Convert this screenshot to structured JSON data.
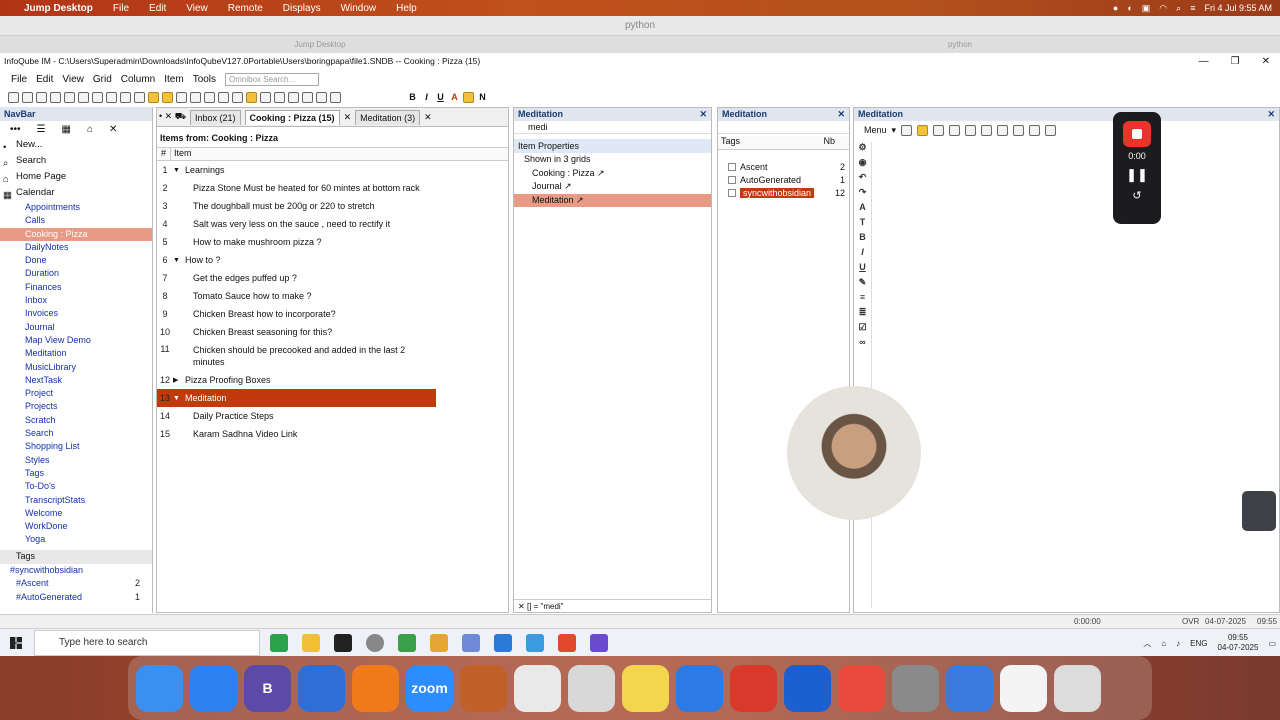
{
  "mac_menubar": {
    "app": "Jump Desktop",
    "items": [
      "File",
      "Edit",
      "View",
      "Remote",
      "Displays",
      "Window",
      "Help"
    ],
    "clock": "Fri 4 Jul  9:55 AM"
  },
  "remote_titlebar": "python",
  "remote_tabs": [
    "Jump Desktop",
    "python"
  ],
  "window": {
    "title": "InfoQube IM - C:\\Users\\Superadmin\\Downloads\\InfoQubeV127.0Portable\\Users\\boringpapa\\file1.SNDB -- Cooking : Pizza (15)"
  },
  "app_menu": [
    "File",
    "Edit",
    "View",
    "Grid",
    "Column",
    "Item",
    "Tools"
  ],
  "omnibox_placeholder": "Omnibox Search...",
  "navbar": {
    "title": "NavBar",
    "top": [
      "New...",
      "Search",
      "Home Page",
      "Calendar"
    ],
    "items": [
      "Appointments",
      "Calls",
      "Cooking : Pizza",
      "DailyNotes",
      "Done",
      "Duration",
      "Finances",
      "Inbox",
      "Invoices",
      "Journal",
      "Map View Demo",
      "Meditation",
      "MusicLibrary",
      "NextTask",
      "Project",
      "Projects",
      "Scratch",
      "Search",
      "Shopping List",
      "Styles",
      "Tags",
      "To-Do's",
      "TranscriptStats",
      "Welcome",
      "WorkDone",
      "Yoga"
    ],
    "selected": "Cooking : Pizza",
    "tags_label": "Tags",
    "tags": [
      {
        "name": "#syncwithobsidian",
        "count": ""
      },
      {
        "name": "#Ascent",
        "count": "2"
      },
      {
        "name": "#AutoGenerated",
        "count": "1"
      }
    ]
  },
  "grid_tabs": [
    "Inbox (21)",
    "Cooking : Pizza (15)",
    "Meditation (3)"
  ],
  "grid": {
    "header_prefix": "Items from:",
    "header_source": "Cooking : Pizza",
    "col_num": "#",
    "col_item": "Item",
    "rows": [
      {
        "n": "1",
        "text": "Learnings",
        "type": "parent"
      },
      {
        "n": "2",
        "text": "Pizza Stone Must be heated for 60 mintes at bottom rack",
        "type": "child"
      },
      {
        "n": "3",
        "text": "The doughball must be 200g or 220 to stretch",
        "type": "child"
      },
      {
        "n": "4",
        "text": "Salt was very less on the sauce , need to rectify it",
        "type": "child"
      },
      {
        "n": "5",
        "text": "How to make mushroom pizza ?",
        "type": "child"
      },
      {
        "n": "6",
        "text": "How to ?",
        "type": "parent"
      },
      {
        "n": "7",
        "text": "Get the edges puffed up ?",
        "type": "child"
      },
      {
        "n": "8",
        "text": "Tomato Sauce how to make ?",
        "type": "child"
      },
      {
        "n": "9",
        "text": "Chicken Breast how to incorporate?",
        "type": "child"
      },
      {
        "n": "10",
        "text": "Chicken Breast seasoning for this?",
        "type": "child"
      },
      {
        "n": "11",
        "text": "Chicken should be precooked and added in the last 2 minutes",
        "type": "child"
      },
      {
        "n": "12",
        "text": "Pizza Proofing Boxes",
        "type": "parent"
      },
      {
        "n": "13",
        "text": "Meditation",
        "type": "parent"
      },
      {
        "n": "14",
        "text": "Daily Practice Steps",
        "type": "child"
      },
      {
        "n": "15",
        "text": "Karam Sadhna Video Link",
        "type": "child"
      }
    ]
  },
  "props_panel": {
    "title": "Meditation",
    "filter": "medi",
    "section": "Item Properties",
    "shown_in": "Shown in 3 grids",
    "grids": [
      "Cooking : Pizza",
      "Journal",
      "Meditation"
    ],
    "footer": "[] = \"medi\""
  },
  "tags_panel": {
    "title": "Meditation",
    "col_tags": "Tags",
    "col_nb": "Nb",
    "tags": [
      {
        "name": "Ascent",
        "count": "2"
      },
      {
        "name": "AutoGenerated",
        "count": "1"
      },
      {
        "name": "syncwithobsidian",
        "count": "12"
      }
    ]
  },
  "notes_panel": {
    "title": "Meditation",
    "menu": "Menu"
  },
  "recorder": {
    "time": "0:00"
  },
  "statusbar": {
    "elapsed": "0:00:00",
    "mode": "OVR",
    "date": "04-07-2025",
    "time": "09:55"
  },
  "taskbar": {
    "search_placeholder": "Type here to search",
    "lang": "ENG",
    "time": "09:55",
    "date": "04-07-2025"
  },
  "dock": [
    {
      "name": "Finder",
      "color": "#3b8ff0"
    },
    {
      "name": "Safari",
      "color": "#2e7ff0"
    },
    {
      "name": "B",
      "color": "#5c4aa8",
      "label": "B"
    },
    {
      "name": "Bookmarks",
      "color": "#2d6fd6"
    },
    {
      "name": "Books",
      "color": "#f07a1a"
    },
    {
      "name": "Zoom",
      "color": "#2d8cff",
      "label": "zoom"
    },
    {
      "name": "Keychain",
      "color": "#c0612a"
    },
    {
      "name": "Chrome",
      "color": "#e9e9e9"
    },
    {
      "name": "Script",
      "color": "#d8d8d8"
    },
    {
      "name": "Notes",
      "color": "#f4d64e"
    },
    {
      "name": "Xcode Tools",
      "color": "#2c7be5"
    },
    {
      "name": "Paprika",
      "color": "#d8392b"
    },
    {
      "name": "1Password",
      "color": "#1b5fd1"
    },
    {
      "name": "Jump",
      "color": "#e84b3c"
    },
    {
      "name": "System Settings",
      "color": "#8a8a8a"
    },
    {
      "name": "1Password 2",
      "color": "#3a7be0"
    },
    {
      "name": "Document",
      "color": "#f4f4f4"
    },
    {
      "name": "Trash",
      "color": "#dcdcdc"
    }
  ]
}
